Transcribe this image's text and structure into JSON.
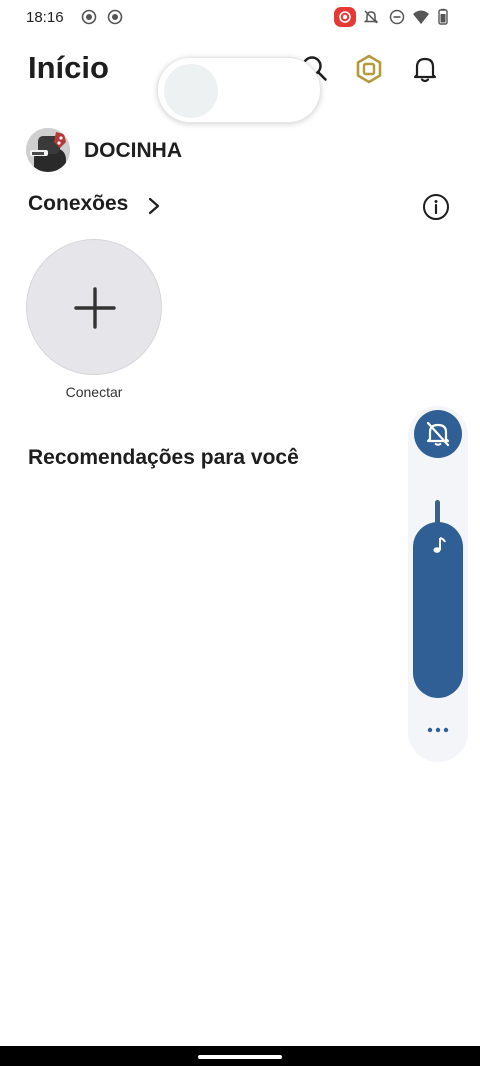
{
  "status_bar": {
    "time": "18:16",
    "left_icons": [
      "record-icon",
      "record-icon"
    ],
    "right_icons": [
      "screen-record-icon",
      "mute-icon",
      "dnd-icon",
      "wifi-icon",
      "battery-icon"
    ]
  },
  "header": {
    "title": "Início",
    "icons": [
      "search-icon",
      "robux-icon",
      "bell-icon"
    ]
  },
  "profile": {
    "username": "DOCINHA"
  },
  "connections": {
    "title": "Conexões",
    "connect_label": "Conectar"
  },
  "recommendations": {
    "title": "Recomendações para você"
  },
  "volume_panel": {
    "accent_color": "#2f5f95",
    "icons": [
      "notifications-off-icon",
      "music-note-icon",
      "more-icon"
    ]
  }
}
